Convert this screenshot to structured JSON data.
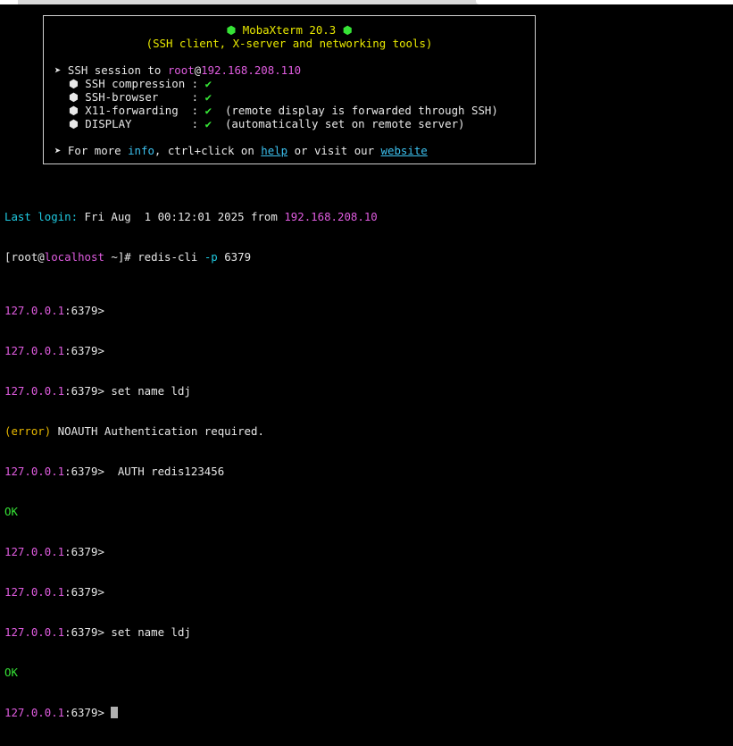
{
  "banner": {
    "title": "MobaXterm 20.3",
    "title_icon": "mobaxterm-logo-icon",
    "subtitle": "(SSH client, X-server and networking tools)",
    "ssh_prefix": "➤ SSH session to ",
    "ssh_user": "root",
    "ssh_at": "@",
    "ssh_host": "192.168.208.110",
    "features": [
      {
        "label": " SSH compression : ",
        "status": "✔",
        "note": ""
      },
      {
        "label": " SSH-browser     : ",
        "status": "✔",
        "note": ""
      },
      {
        "label": " X11-forwarding  : ",
        "status": "✔",
        "note": "  (remote display is forwarded through SSH)"
      },
      {
        "label": " DISPLAY         : ",
        "status": "✔",
        "note": "  (automatically set on remote server)"
      }
    ],
    "more_prefix": "➤ For more ",
    "more_info": "info",
    "more_mid": ", ctrl+click on ",
    "more_help": "help",
    "more_or": " or visit our ",
    "more_website": "website"
  },
  "session": {
    "last_login_label": "Last login:",
    "last_login_date": " Fri Aug  1 00:12:01 2025 from ",
    "last_login_host": "192.168.208.10",
    "shell_prompt_open": "[root@",
    "shell_host": "localhost",
    "shell_prompt_close": " ~]# ",
    "shell_command": "redis-cli ",
    "shell_flag": "-p",
    "shell_port": " 6379",
    "redis_host": "127.0.0.1",
    "redis_port_prompt": ":6379> ",
    "cmd_set_1": "set name ldj",
    "error_label": "(error)",
    "error_message": " NOAUTH Authentication required.",
    "cmd_auth": " AUTH redis123456",
    "ok": "OK",
    "cmd_set_2": "set name ldj"
  },
  "colors": {
    "background": "#000000",
    "text": "#e8e8e8",
    "yellow": "#e8e800",
    "green": "#36e336",
    "magenta": "#e05ce0",
    "cyan": "#1fc9e0",
    "link": "#3cc0ee",
    "error": "#e8b800"
  }
}
